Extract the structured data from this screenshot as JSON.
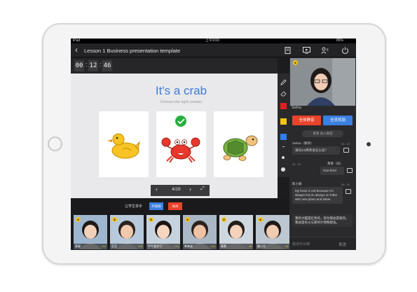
{
  "statusbar": {
    "carrier": "iPad",
    "time": "上午9:00",
    "battery": "85%"
  },
  "nav": {
    "title": "Lesson 1 Business presentation template"
  },
  "timer": {
    "hours": "00",
    "minutes": "12",
    "seconds": "46"
  },
  "slide": {
    "title": "It's a crab",
    "subtitle": "Choose the right answer",
    "page": "4/28"
  },
  "toolbar": {
    "colors": [
      "#e02020",
      "#f5c518",
      "#2f80ed"
    ]
  },
  "panel": {
    "teacher_name": "Selina",
    "mute_all": "全体静音",
    "reward_all": "全员奖励",
    "join_notice": "莱莱 进入教室",
    "messages": [
      {
        "name": "Selina（教师）",
        "time": "08 : 20",
        "text": "请问1/3用英语怎么读？"
      },
      {
        "name": "莱莱（初）",
        "time": "08 : 20",
        "text": "One-third"
      },
      {
        "name": "陈小朋",
        "time": "08 : 20",
        "text": "My brain is red because I'm always hot,Im always on fothe with new plans and ideas."
      },
      {
        "name": "",
        "time": "",
        "text": "我的大脑是红色的，因为我总是很热，我总是有火与新的计划和想法。"
      }
    ],
    "input_placeholder": "说点什么吧",
    "send_label": "发送"
  },
  "controls": {
    "label": "让学生举手",
    "btn_blue": "开视频",
    "btn_red": "关闭"
  },
  "students": [
    {
      "name": "源源",
      "score": "×12"
    },
    {
      "name": "豆豆",
      "score": "×20"
    },
    {
      "name": "牛牛爱学习",
      "score": "×12"
    },
    {
      "name": "笨笨虎",
      "score": "×10"
    },
    {
      "name": "莫莫",
      "score": "×8"
    },
    {
      "name": "路小凡",
      "score": "×8"
    }
  ]
}
